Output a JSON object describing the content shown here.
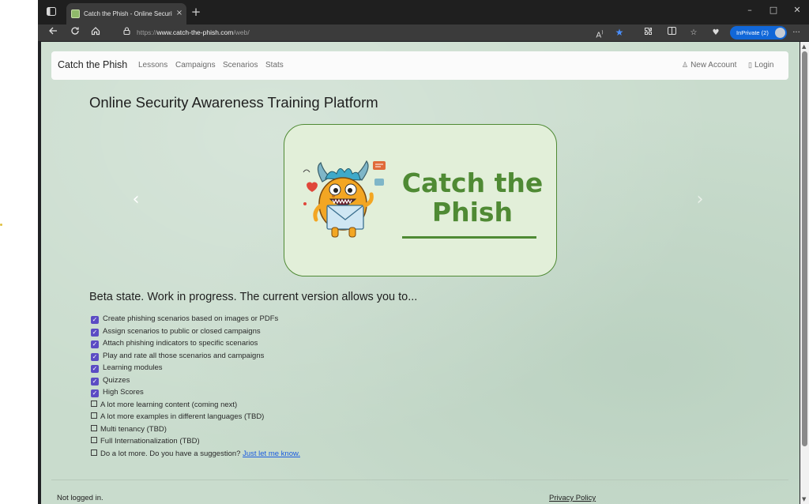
{
  "browser": {
    "tab_title": "Catch the Phish - Online Security",
    "tab_close": "×",
    "new_tab": "+",
    "url_prefix": "https://",
    "url_domain": "www.catch-the-phish.com",
    "url_path": "/web/",
    "inprivate_label": "InPrivate (2)",
    "window_controls": {
      "minimize": "–",
      "maximize": "□",
      "close": "✕"
    },
    "icons": {
      "tab_actions": "tab-actions-icon",
      "back": "back-icon",
      "refresh": "refresh-icon",
      "home": "home-icon",
      "lock": "lock-icon",
      "read_aloud": "read-aloud-icon",
      "favorite": "favorite-star-icon",
      "extensions": "extensions-icon",
      "split_screen": "split-screen-icon",
      "favorites": "favorites-icon",
      "browser_essentials": "browser-essentials-icon",
      "more": "more-icon"
    },
    "accent_color": "#1167d8"
  },
  "navbar": {
    "brand": "Catch the Phish",
    "links": [
      "Lessons",
      "Campaigns",
      "Scenarios",
      "Stats"
    ],
    "new_account": "New Account",
    "login": "Login"
  },
  "main": {
    "heading": "Online Security Awareness Training Platform",
    "banner_title": "Catch  the\nPhish",
    "carousel_prev": "‹",
    "carousel_next": "›",
    "beta_heading": "Beta state. Work in progress. The current version allows you to...",
    "features": [
      {
        "label": "Create phishing scenarios based on images or PDFs",
        "done": true
      },
      {
        "label": "Assign scenarios to public or closed campaigns",
        "done": true
      },
      {
        "label": "Attach phishing indicators to specific scenarios",
        "done": true
      },
      {
        "label": "Play and rate all those scenarios and campaigns",
        "done": true
      },
      {
        "label": "Learning modules",
        "done": true
      },
      {
        "label": "Quizzes",
        "done": true
      },
      {
        "label": "High Scores",
        "done": true
      },
      {
        "label": "A lot more learning content (coming next)",
        "done": false
      },
      {
        "label": "A lot more examples in different languages (TBD)",
        "done": false
      },
      {
        "label": "Multi tenancy (TBD)",
        "done": false
      },
      {
        "label": "Full Internationalization (TBD)",
        "done": false
      }
    ],
    "last_feature_text": "Do a lot more. Do you have a suggestion?",
    "last_feature_link": "Just let me know."
  },
  "footer": {
    "status": "Not logged in.",
    "privacy": "Privacy Policy"
  },
  "colors": {
    "page_background": "#c9dccd",
    "brand_green": "#4f8a34",
    "checkbox_purple": "#5b4bc4",
    "link_blue": "#1a5be0"
  }
}
